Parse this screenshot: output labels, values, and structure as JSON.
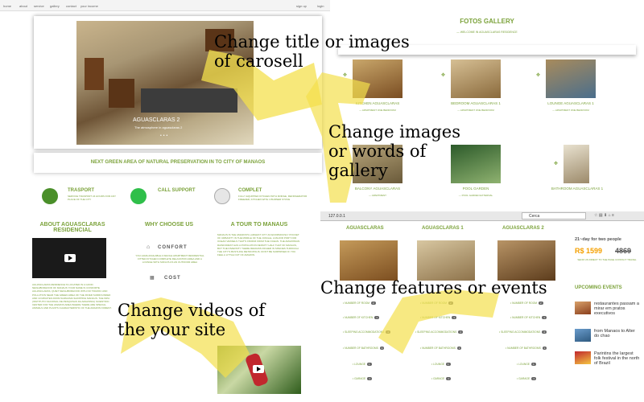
{
  "nav": {
    "items": [
      "home",
      "about",
      "service",
      "gallery",
      "contact",
      "your income"
    ],
    "signup": "sign up",
    "login": "login"
  },
  "carousel": {
    "title": "AGUASCLARAS 2",
    "subtitle": "The atmosphere in aguasclaras 2",
    "dots": "•••"
  },
  "banner": {
    "text": "NEXT GREEN AREA OF NATURAL PRESERVATION IN TO CITY OF MANAOS"
  },
  "features": [
    {
      "title": "TRASPORT",
      "text": "SERVICE TRASPORT 24 HOURS FOR ANY PLACE OF THE CITY",
      "icon": "bus-icon"
    },
    {
      "title": "CALL SUPPORT",
      "text": "",
      "icon": "whatsapp-icon"
    },
    {
      "title": "COMPLET",
      "text": "FULLY EQUIPPED KITCHEN WITH FRIDGE, REFRIGERATOR FREEZER, KITCHEN WITH 4 BURNER STOVE",
      "icon": "home-icon"
    }
  ],
  "about": {
    "title": "ABOUT AGUASCLARAS RESIDENCIAL",
    "text": "AGUASCLARAS RESIDENCE IS LOCATED IN A GOOD NEIGHBORHOOD OF MANAUS YOUR NAME IS CONFORTE AGUASCLARAS, QUIET NEIGHBORHOOD WITH NO TRAFFIC AND POLLUTION NEAR THE GREEN AREA OF THE RIVER SURROUNDED AND 10 MINUTES FROM SUMAUMA SHOPPING MANAUS. THE INPA (INSTITUTO NACIONAL DE PESQUISAS DA AMAZONIA) SCIENTIFIC CENTER FOR THE AMAZON AREA WHERE THERE ARE SPECIAL ANIMALS AND PLANTS CHARACTERISTIC OF THE AMAZON FOREST."
  },
  "why": {
    "title": "WHY CHOOSE US",
    "item1_title": "CONFORT",
    "item1_text": "YOU HAVE AVAILABLE A WHOLE APARTMENT RESIDENTIAL FITTED KITCHEN COMPLETE RELAXATION AREA AND A LOUNGE WITH SOFA PLUS AN OUTDOOR AREA",
    "item2_title": "COST"
  },
  "tour": {
    "title": "A TOUR TO MANAUS",
    "text": "MANAUS IS THE AMAZON'S LARGEST CITY AN ENORMOUSLY POCKET OF URBANITY IN THE MIDDLE OF THE JUNGLE, A MAJOR PORT FOR OCEAN VESSELS THAT'S 1500KM FROM THE OCEAN. THE AMAZONIAN RAINFOREST HAS A POPULATION DENSITY HALF THAT OF MANAUS, BUT THE DIVERSITY THERE REMAINS RICHER IN SPECIES THROUGH THE CITY'S BUSTLING METROPOLIS. DON'T BE SURPRISED IF YOU FEEL A LITTLE OUT OF AMAZON."
  },
  "gallery": {
    "title": "FOTOS GALLERY",
    "subtitle": "— WELCOME IN AGUASCLARAS RESIDENCE",
    "items": [
      {
        "title": "KITCHEN AGUASCLARAS",
        "sub": "— APARTMENT ONE BEDROOM"
      },
      {
        "title": "BEDROOM AGUASCLARAS 1",
        "sub": "— APARTMENT ONE BEDROOM"
      },
      {
        "title": "LOUNGE AGUASCLARAS 1",
        "sub": "— APARTMENT ONE BEDROOM"
      },
      {
        "title": "BALCONY AGUASCLARAS",
        "sub": "— APARTMENT"
      },
      {
        "title": "POOL GARDEN",
        "sub": "— POOL GARDEN EXTERNAL"
      },
      {
        "title": "BATHROOM AGUASCLARAS 1",
        "sub": "— APARTMENT ONE BEDROOM"
      }
    ]
  },
  "browser": {
    "url": "127.0.0.1",
    "search": "Cerca"
  },
  "rooms": {
    "columns": [
      {
        "title": "AGUASCLARAS"
      },
      {
        "title": "AGUASCLARAS 1"
      },
      {
        "title": "AGUASCLARAS 2"
      }
    ],
    "rows": [
      "NUMBER OF ROOM",
      "NUMBER OF KITCHEN",
      "SLEEPING ACCOMMODATIONS",
      "NUMBER OF BATHROOMS",
      "LOUNGE",
      "GARAGE"
    ],
    "badges": [
      "2",
      "1",
      "4",
      "1",
      "1",
      "1"
    ]
  },
  "offer": {
    "title": "21~day for two people",
    "price": "R$ 1599",
    "old_price": "4869",
    "note": "SEND US DIRECT TO THE PAGE CONTACT TRAVEL"
  },
  "events": {
    "title": "UPCOMING EVENTS",
    "items": [
      "restaurantes passam a mirar em pratos executivos",
      "from Manaos to Alter do chao",
      "Parintins the largest folk festival in the north of Brazil"
    ]
  },
  "callouts": {
    "carousel": "Change title or images of carosell",
    "gallery": "Change images or words of gallery",
    "features": "Change features or events",
    "videos": "Change videos of the your site"
  },
  "colors": {
    "accent": "#7ba23a",
    "arrow": "#f4e04d",
    "price": "#f5a000"
  }
}
